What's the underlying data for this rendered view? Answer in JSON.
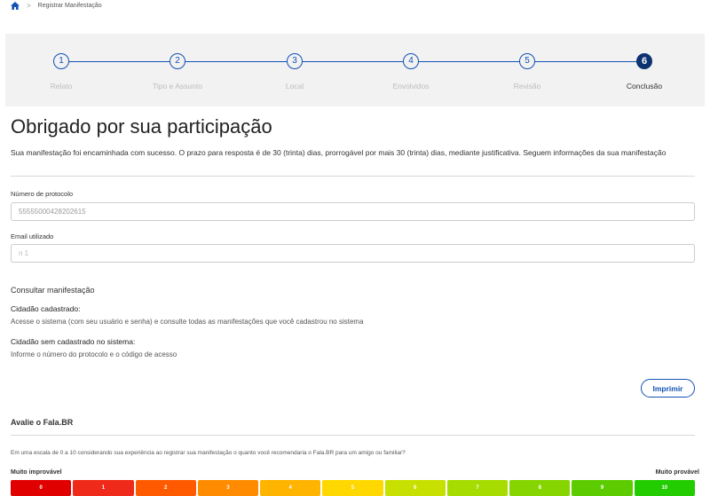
{
  "breadcrumb": {
    "current": "Registrar Manifestação",
    "separator": ">"
  },
  "steps": [
    {
      "number": "1",
      "label": "Relato"
    },
    {
      "number": "2",
      "label": "Tipo e Assunto"
    },
    {
      "number": "3",
      "label": "Local"
    },
    {
      "number": "4",
      "label": "Envolvidos"
    },
    {
      "number": "5",
      "label": "Revisão"
    },
    {
      "number": "6",
      "label": "Conclusão"
    }
  ],
  "active_step": 6,
  "title": "Obrigado por sua participação",
  "intro": "Sua manifestação foi encaminhada com sucesso. O prazo para resposta é de 30 (trinta) dias, prorrogável por mais 30 (trinta) dias, mediante justificativa. Seguem informações da sua manifestação",
  "protocol": {
    "label": "Número de protocolo",
    "value": "55555000428202615"
  },
  "email": {
    "label": "Email utilizado",
    "value": "n                              1"
  },
  "consult": {
    "heading": "Consultar manifestação",
    "registered_heading": "Cidadão cadastrado:",
    "registered_text": "Acesse o sistema (com seu usuário e senha) e consulte todas as manifestações que você cadastrou no sistema",
    "unregistered_heading": "Cidadão sem cadastrado no sistema:",
    "unregistered_text": "Informe o número do protocolo e o código de acesso"
  },
  "print_label": "Imprimir",
  "rating": {
    "heading": "Avalie o Fala.BR",
    "question": "Em uma escala de 0 a 10 considerando sua experiência ao registrar sua manifestação o quanto você recomendaria o Fala.BR para um amigo ou familiar?",
    "low_label": "Muito improvável",
    "high_label": "Muito provável",
    "options": [
      "0",
      "1",
      "2",
      "3",
      "4",
      "5",
      "6",
      "7",
      "8",
      "9",
      "10"
    ],
    "colors": [
      "#e00000",
      "#f02a1a",
      "#ff5a00",
      "#ff8c00",
      "#ffb400",
      "#ffd800",
      "#c8e000",
      "#a6dc00",
      "#86d400",
      "#5ccc00",
      "#22cc00"
    ]
  },
  "colors": {
    "primary": "#1351b4",
    "active_step": "#0c326f"
  }
}
